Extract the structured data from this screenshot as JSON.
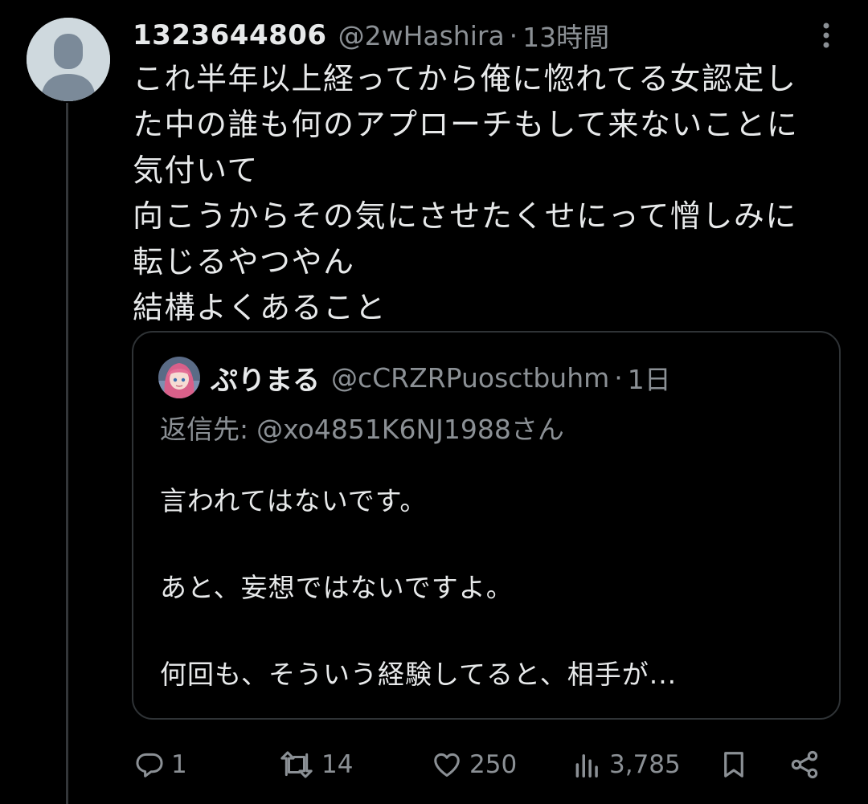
{
  "tweet": {
    "display_name": "1323644806",
    "handle": "@2wHashira",
    "separator": "·",
    "time": "13時間",
    "text": "これ半年以上経ってから俺に惚れてる女認定し\nた中の誰も何のアプローチもして来ないことに\n気付いて\n向こうからその気にさせたくせにって憎しみに\n転じるやつやん\n結構よくあること"
  },
  "quote": {
    "display_name": "ぷりまる",
    "handle": "@cCRZRPuosctbuhm",
    "separator": "·",
    "time": "1日",
    "reply_label": "返信先:",
    "reply_mention": "@xo4851K6NJ1988さん",
    "paragraphs": [
      "言われてはないです。",
      "あと、妄想ではないですよ。",
      "何回も、そういう経験してると、相手が..."
    ]
  },
  "actions": {
    "replies": "1",
    "reposts": "14",
    "likes": "250",
    "views": "3,785"
  },
  "icons": {
    "avatar": "default-avatar-icon",
    "more": "more-options-icon",
    "reply": "reply-icon",
    "repost": "repost-icon",
    "like": "heart-icon",
    "views": "views-icon",
    "bookmark": "bookmark-icon",
    "share": "share-icon"
  },
  "colors": {
    "background": "#000000",
    "text": "#e7e9ea",
    "secondary_text": "#8b9095",
    "border": "#2f3336",
    "avatar_bg": "#cfd9de",
    "avatar_fg": "#7b8a99"
  }
}
